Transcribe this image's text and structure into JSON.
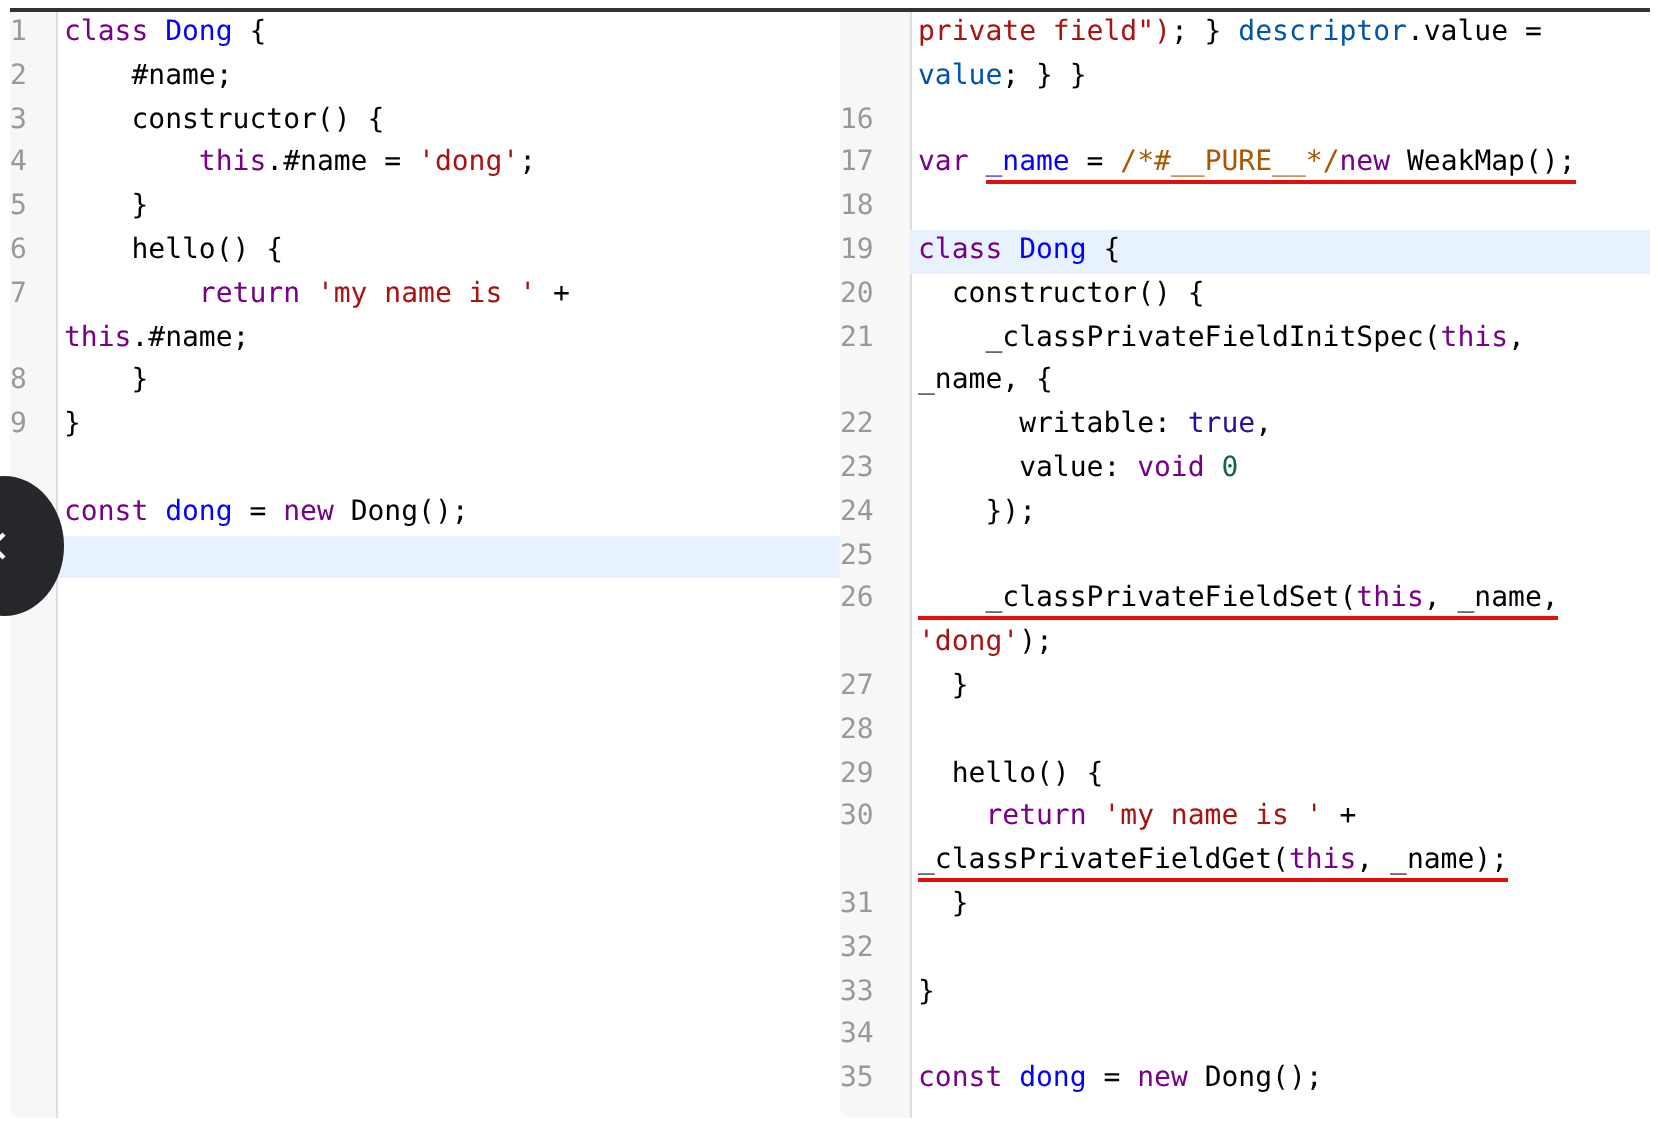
{
  "panes": [
    {
      "lines": [
        {
          "num": "1",
          "tokens": [
            {
              "t": "class ",
              "kind": "kw"
            },
            {
              "t": "Dong",
              "kind": "def"
            },
            {
              "t": " {"
            }
          ]
        },
        {
          "num": "2",
          "tokens": [
            {
              "t": "    #name;"
            }
          ]
        },
        {
          "num": "3",
          "tokens": [
            {
              "t": "    constructor() {"
            }
          ]
        },
        {
          "num": "4",
          "tokens": [
            {
              "t": "        this",
              "kind": "kw"
            },
            {
              "t": ".#name = "
            },
            {
              "t": "'dong'",
              "kind": "str"
            },
            {
              "t": ";"
            }
          ]
        },
        {
          "num": "5",
          "tokens": [
            {
              "t": "    }"
            }
          ]
        },
        {
          "num": "6",
          "tokens": [
            {
              "t": "    hello() {"
            }
          ]
        },
        {
          "num": "7",
          "tokens": [
            {
              "t": "        return ",
              "kind": "kw"
            },
            {
              "t": "'my name is '",
              "kind": "str"
            },
            {
              "t": " +"
            }
          ]
        },
        {
          "tokens": [
            {
              "t": "this",
              "kind": "kw"
            },
            {
              "t": ".#name;"
            }
          ]
        },
        {
          "num": "8",
          "tokens": [
            {
              "t": "    }"
            }
          ]
        },
        {
          "num": "9",
          "tokens": [
            {
              "t": "}"
            }
          ]
        },
        {
          "blank": true
        },
        {
          "tokens": [
            {
              "t": "const ",
              "kind": "kw"
            },
            {
              "t": "dong",
              "kind": "def"
            },
            {
              "t": " = "
            },
            {
              "t": "new",
              "kind": "kw"
            },
            {
              "t": " Dong();"
            }
          ]
        },
        {
          "highlighted": true
        }
      ]
    },
    {
      "lines": [
        {
          "tokens": [
            {
              "t": "private field\")",
              "kind": "str"
            },
            {
              "t": "; } "
            },
            {
              "t": "descriptor",
              "kind": "prop"
            },
            {
              "t": ".value ="
            }
          ]
        },
        {
          "tokens": [
            {
              "t": "value",
              "kind": "prop"
            },
            {
              "t": "; } }"
            }
          ]
        },
        {
          "num": "16"
        },
        {
          "num": "17",
          "tokens": [
            {
              "t": "var ",
              "kind": "kw"
            },
            {
              "t": "_name",
              "kind": "def",
              "marked": true
            },
            {
              "t": " = ",
              "marked": true
            },
            {
              "t": "/*#__PURE__*/",
              "kind": "comment",
              "marked": true
            },
            {
              "t": "new",
              "kind": "kw",
              "marked": true
            },
            {
              "t": " WeakMap();",
              "marked": true
            }
          ]
        },
        {
          "num": "18"
        },
        {
          "num": "19",
          "tokens": [
            {
              "t": "class ",
              "kind": "kw"
            },
            {
              "t": "Dong",
              "kind": "def"
            },
            {
              "t": " {"
            }
          ],
          "highlighted": true
        },
        {
          "num": "20",
          "tokens": [
            {
              "t": "  constructor() {"
            }
          ]
        },
        {
          "num": "21",
          "tokens": [
            {
              "t": "    _classPrivateFieldInitSpec("
            },
            {
              "t": "this",
              "kind": "kw"
            },
            {
              "t": ","
            }
          ]
        },
        {
          "tokens": [
            {
              "t": "_name, {"
            }
          ]
        },
        {
          "num": "22",
          "tokens": [
            {
              "t": "      writable: "
            },
            {
              "t": "true",
              "kind": "atom"
            },
            {
              "t": ","
            }
          ]
        },
        {
          "num": "23",
          "tokens": [
            {
              "t": "      value: "
            },
            {
              "t": "void ",
              "kind": "kw"
            },
            {
              "t": "0",
              "kind": "number"
            }
          ]
        },
        {
          "num": "24",
          "tokens": [
            {
              "t": "    });"
            }
          ]
        },
        {
          "num": "25"
        },
        {
          "num": "26",
          "tokens": [
            {
              "t": "    _classPrivateFieldSet(",
              "marked": true
            },
            {
              "t": "this",
              "kind": "kw",
              "marked": true
            },
            {
              "t": ", _name,",
              "marked": true
            }
          ]
        },
        {
          "tokens": [
            {
              "t": "'dong'",
              "kind": "str"
            },
            {
              "t": ");"
            }
          ]
        },
        {
          "num": "27",
          "tokens": [
            {
              "t": "  }"
            }
          ]
        },
        {
          "num": "28"
        },
        {
          "num": "29",
          "tokens": [
            {
              "t": "  hello() {"
            }
          ]
        },
        {
          "num": "30",
          "tokens": [
            {
              "t": "    return ",
              "kind": "kw"
            },
            {
              "t": "'my name is '",
              "kind": "str"
            },
            {
              "t": " +"
            }
          ]
        },
        {
          "tokens": [
            {
              "t": "_classPrivateFieldGet(",
              "marked": true
            },
            {
              "t": "this",
              "kind": "kw",
              "marked": true
            },
            {
              "t": ", _name);",
              "marked": true
            }
          ]
        },
        {
          "num": "31",
          "tokens": [
            {
              "t": "  }"
            }
          ]
        },
        {
          "num": "32"
        },
        {
          "num": "33",
          "tokens": [
            {
              "t": "}"
            }
          ]
        },
        {
          "num": "34"
        },
        {
          "num": "35",
          "tokens": [
            {
              "t": "const ",
              "kind": "kw"
            },
            {
              "t": "dong",
              "kind": "def"
            },
            {
              "t": " = "
            },
            {
              "t": "new",
              "kind": "kw"
            },
            {
              "t": " Dong();"
            }
          ]
        }
      ]
    }
  ]
}
